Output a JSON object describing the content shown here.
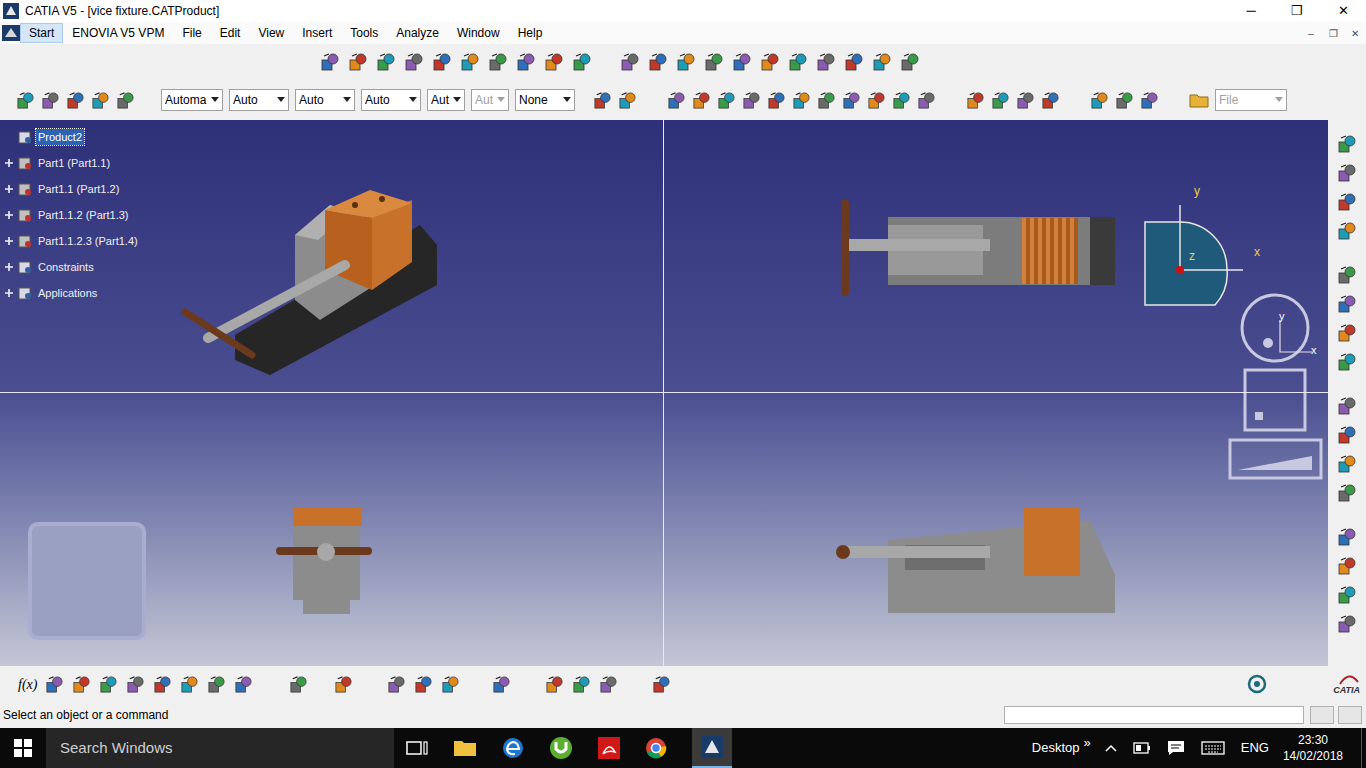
{
  "window": {
    "title": "CATIA V5 - [vice fixture.CATProduct]",
    "controls": [
      "─",
      "❐",
      "✕"
    ]
  },
  "menu": [
    {
      "label": "Start",
      "selected": true
    },
    {
      "label": "ENOVIA V5 VPM",
      "selected": false
    },
    {
      "label": "File",
      "selected": false
    },
    {
      "label": "Edit",
      "selected": false
    },
    {
      "label": "View",
      "selected": false
    },
    {
      "label": "Insert",
      "selected": false
    },
    {
      "label": "Tools",
      "selected": false
    },
    {
      "label": "Analyze",
      "selected": false
    },
    {
      "label": "Window",
      "selected": false
    },
    {
      "label": "Help",
      "selected": false
    }
  ],
  "document_controls": [
    "–",
    "❐",
    "✕"
  ],
  "graphic_properties": [
    {
      "value": "Automa",
      "disabled": false
    },
    {
      "value": "Auto",
      "disabled": false
    },
    {
      "value": "Auto",
      "disabled": false
    },
    {
      "value": "Auto",
      "disabled": false
    },
    {
      "value": "Aut",
      "disabled": false
    },
    {
      "value": "Aut",
      "disabled": true
    },
    {
      "value": "None",
      "disabled": false
    }
  ],
  "file_dropdown": {
    "value": "File",
    "disabled": true
  },
  "tree": [
    {
      "label": "Product2",
      "selected": true,
      "expandable": false
    },
    {
      "label": "Part1 (Part1.1)",
      "selected": false,
      "expandable": true
    },
    {
      "label": "Part1.1 (Part1.2)",
      "selected": false,
      "expandable": true
    },
    {
      "label": "Part1.1.2 (Part1.3)",
      "selected": false,
      "expandable": true
    },
    {
      "label": "Part1.1.2.3 (Part1.4)",
      "selected": false,
      "expandable": true
    },
    {
      "label": "Constraints",
      "selected": false,
      "expandable": true
    },
    {
      "label": "Applications",
      "selected": false,
      "expandable": true
    }
  ],
  "compass": {
    "y": "y",
    "z": "z",
    "x": "x"
  },
  "view_cube": {
    "y": "y",
    "x": "x"
  },
  "bottom_toolbar": {
    "formula": "f(x)"
  },
  "logo": "CATIA",
  "status_bar": {
    "prompt": "Select an object or a command",
    "input": ""
  },
  "taskbar": {
    "search": "Search Windows",
    "desktop": "Desktop",
    "more": "»",
    "language": "ENG",
    "time": "23:30",
    "date": "14/02/2018"
  }
}
